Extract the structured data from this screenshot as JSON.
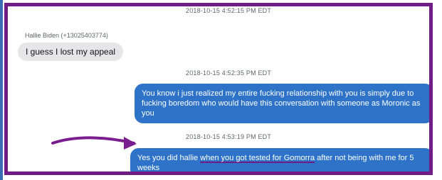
{
  "conversation": {
    "messages": [
      {
        "timestamp": "2018-10-15 4:52:15 PM EDT",
        "sender": "Hallie Biden (+13025403774)",
        "text": "I guess I lost my appeal",
        "direction": "incoming"
      },
      {
        "timestamp": "2018-10-15 4:52:35 PM EDT",
        "text": "You know i just realized my entire fucking relationship with you is simply due to fucking boredom who would have this conversation with someone as Moronic as you",
        "direction": "outgoing"
      },
      {
        "timestamp": "2018-10-15 4:53:19 PM EDT",
        "text_before": "Yes you did hallie ",
        "text_underlined": "when you got tested for Gomorra",
        "text_after": " after not being with me for 5 weeks",
        "direction": "outgoing"
      }
    ]
  },
  "colors": {
    "frame": "#6f1c86",
    "outgoing_bubble": "#2f73c9",
    "incoming_bubble": "#e6e6e9",
    "arrow": "#7a1d8e"
  },
  "annotations": {
    "arrow_icon": "right-arrow-icon"
  }
}
